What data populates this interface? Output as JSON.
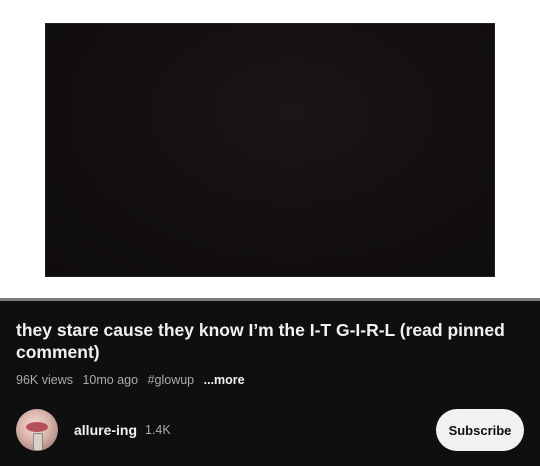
{
  "video": {
    "title": "they stare cause they know I’m the I-T G-I-R-L (read pinned comment)",
    "views": "96K views",
    "age": "10mo ago",
    "hashtag": "#glowup",
    "more_label": "...more"
  },
  "channel": {
    "name": "allure-ing",
    "subscriber_count": "1.4K",
    "avatar_icon": "avatar-lips-perfume-image",
    "subscribe_label": "Subscribe"
  },
  "colors": {
    "panel_bg": "#0f0f0f",
    "title_text": "#f1f1f1",
    "meta_text": "#aaaaaa",
    "button_bg": "#f1f1f1"
  }
}
